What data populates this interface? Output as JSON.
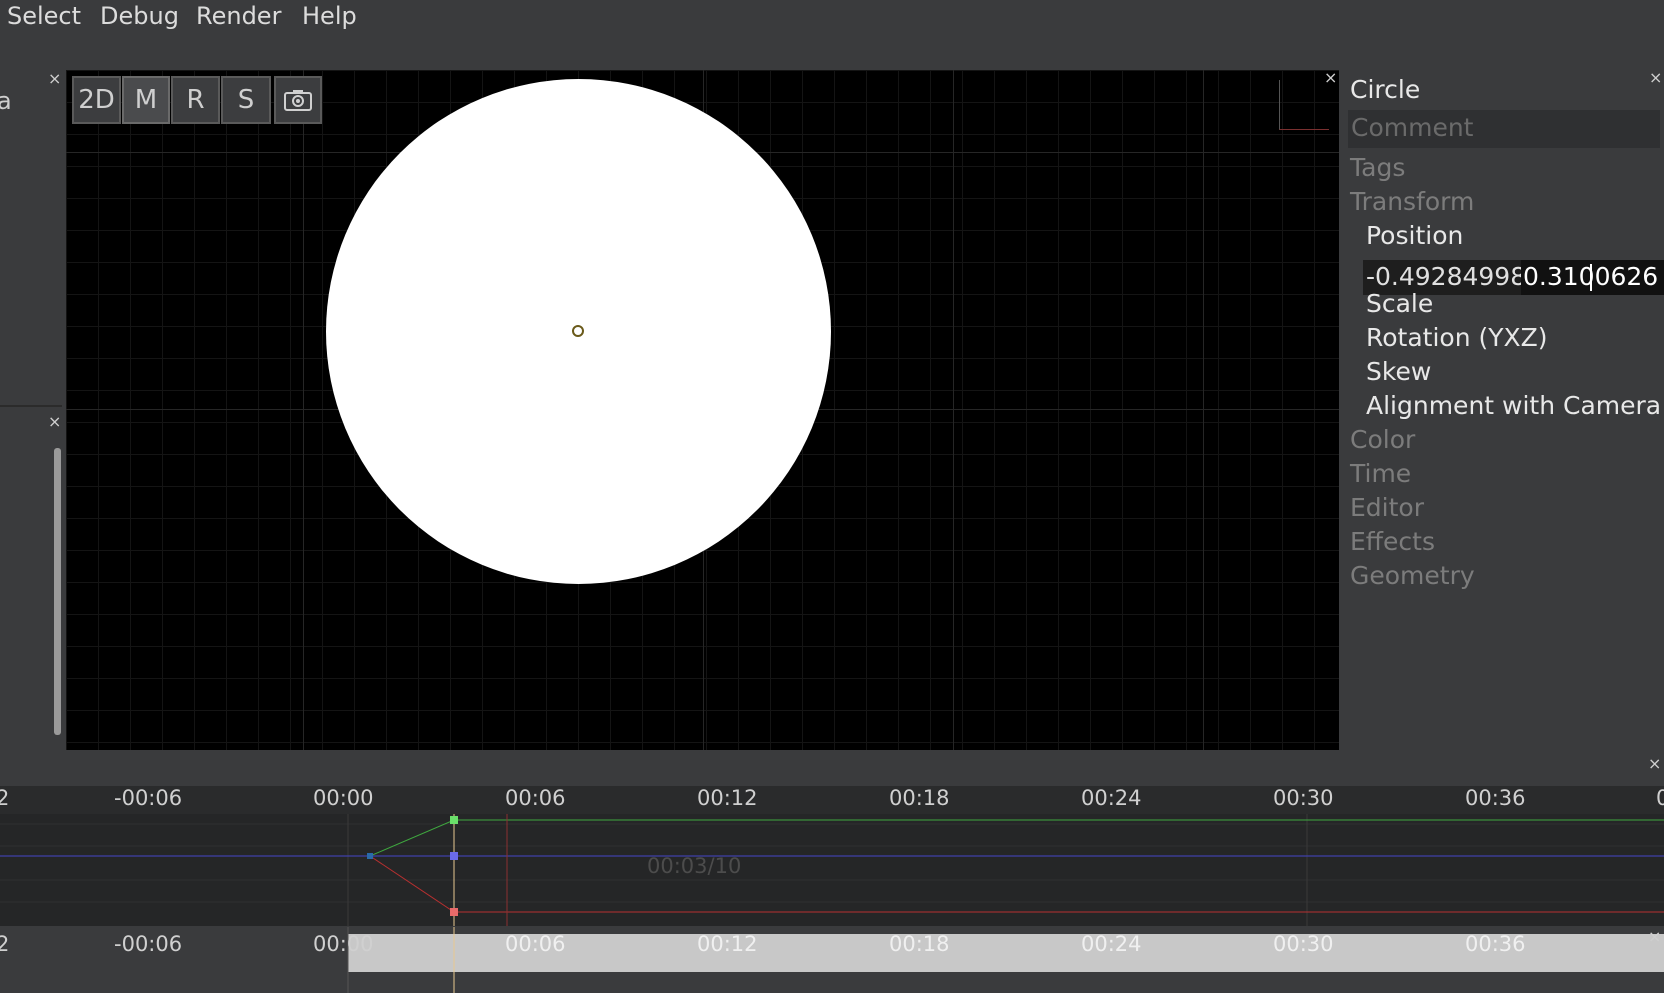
{
  "menu": {
    "items": [
      "Select",
      "Debug",
      "Render",
      "Help"
    ]
  },
  "left_panel": {
    "top_text": "a",
    "close": "×"
  },
  "viewport": {
    "buttons": {
      "mode_2d": "2D",
      "move": "M",
      "rotate": "R",
      "scale": "S"
    },
    "close": "×"
  },
  "properties": {
    "title": "Circle",
    "comment_placeholder": "Comment",
    "tags": "Tags",
    "transform": "Transform",
    "position": "Position",
    "position_x": "-0.49284998",
    "position_y": "0.3100626",
    "scale": "Scale",
    "rotation": "Rotation (YXZ)",
    "skew": "Skew",
    "alignment": "Alignment with Camera",
    "color": "Color",
    "time": "Time",
    "editor": "Editor",
    "effects": "Effects",
    "geometry": "Geometry",
    "close": "×"
  },
  "timeline": {
    "ticks": [
      "2",
      "-00:06",
      "00:00",
      "00:06",
      "00:12",
      "00:18",
      "00:24",
      "00:30",
      "00:36",
      "0"
    ],
    "ticks_bottom": [
      "2",
      "-00:06",
      "00:00",
      "00:06",
      "00:12",
      "00:18",
      "00:24",
      "00:30",
      "00:36"
    ],
    "current_time": "00:03/10",
    "close": "×",
    "colors": {
      "green": "#3fa83f",
      "blue": "#4545c8",
      "red": "#b83030",
      "playhead": "#e8c890"
    }
  }
}
